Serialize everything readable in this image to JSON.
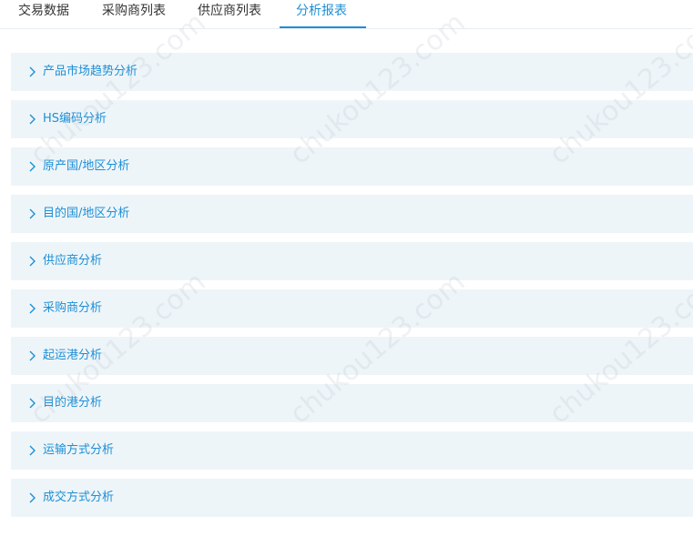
{
  "tabs": [
    {
      "label": "交易数据",
      "active": false
    },
    {
      "label": "采购商列表",
      "active": false
    },
    {
      "label": "供应商列表",
      "active": false
    },
    {
      "label": "分析报表",
      "active": true
    }
  ],
  "sections": [
    {
      "label": "产品市场趋势分析"
    },
    {
      "label": "HS编码分析"
    },
    {
      "label": "原产国/地区分析"
    },
    {
      "label": "目的国/地区分析"
    },
    {
      "label": "供应商分析"
    },
    {
      "label": "采购商分析"
    },
    {
      "label": "起运港分析"
    },
    {
      "label": "目的港分析"
    },
    {
      "label": "运输方式分析"
    },
    {
      "label": "成交方式分析"
    }
  ],
  "watermark": "chukou123.com",
  "colors": {
    "accent": "#1d8fd6",
    "row_bg": "#eef5f9",
    "tab_text": "#333333"
  },
  "icons": {
    "row_icon": "chevron-right-icon"
  }
}
